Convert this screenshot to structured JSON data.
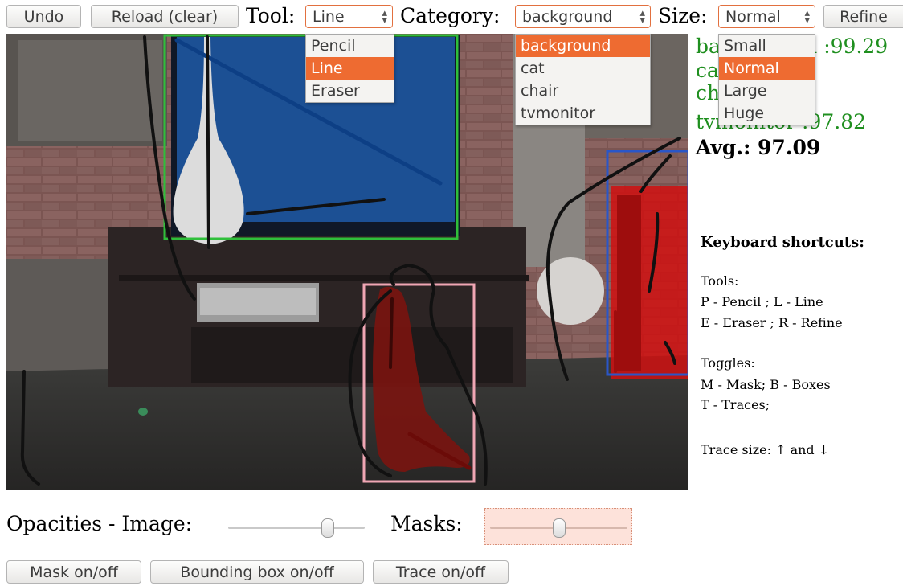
{
  "toolbar": {
    "undo_label": "Undo",
    "reload_label": "Reload (clear)",
    "tool_label": "Tool:",
    "tool_value": "Line",
    "tool_options": [
      "Pencil",
      "Line",
      "Eraser"
    ],
    "category_label": "Category:",
    "category_value": "background",
    "category_options": [
      "background",
      "cat",
      "chair",
      "tvmonitor"
    ],
    "size_label": "Size:",
    "size_value": "Normal",
    "size_options": [
      "Small",
      "Normal",
      "Large",
      "Huge"
    ],
    "refine_label": "Refine"
  },
  "scores": {
    "background": "background :99.29",
    "cat": "cat",
    "chair": "chair",
    "tvmonitor": "tvmonitor :97.82",
    "average": "Avg.: 97.09"
  },
  "shortcuts": {
    "title": "Keyboard shortcuts:",
    "tools_heading": "Tools:",
    "line1": "P - Pencil ; L - Line",
    "line2": "E - Eraser ; R - Refine",
    "toggles_heading": "Toggles:",
    "line3": "M - Mask; B - Boxes",
    "line4": "T - Traces;",
    "trace_size": "Trace size: ↑ and ↓"
  },
  "opacities": {
    "image_label": "Opacities - Image:",
    "masks_label": "Masks:",
    "image_value": 0.75,
    "masks_value": 0.5
  },
  "bottom_buttons": {
    "mask_toggle": "Mask on/off",
    "box_toggle": "Bounding box on/off",
    "trace_toggle": "Trace on/off"
  },
  "colors": {
    "accent": "#ee6b31",
    "score_green": "#1f8f1f",
    "box_tv": "#2fbf3a",
    "box_cat": "#f0a6b4",
    "box_chair": "#2a56c8",
    "mask_tv": "#1e5aa8",
    "mask_cat": "#7a1410",
    "mask_chair": "#d01010"
  }
}
